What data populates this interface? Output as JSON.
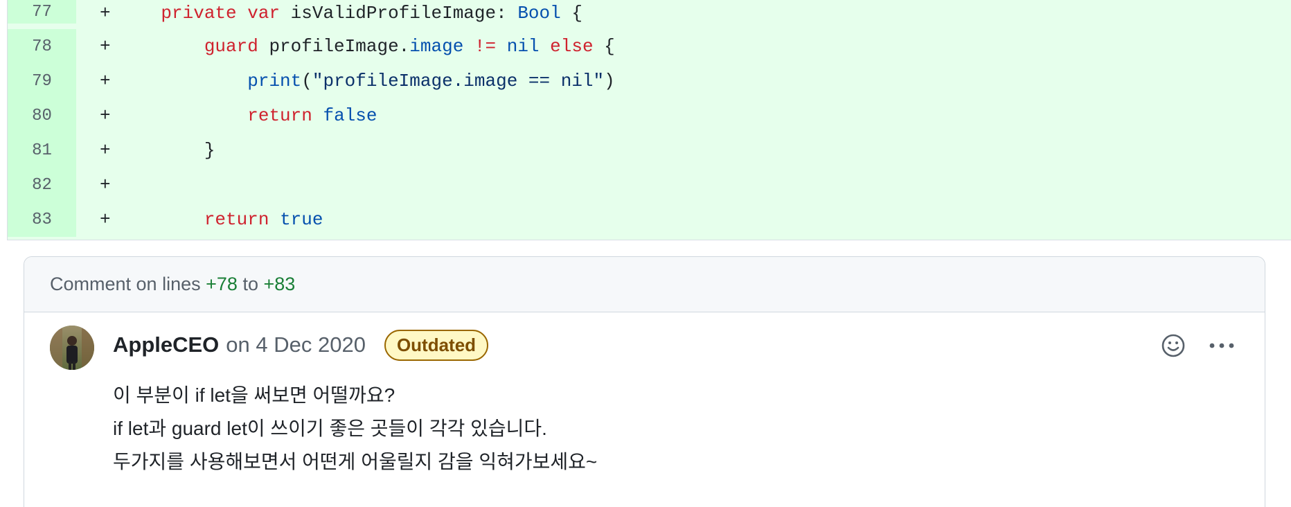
{
  "diff": {
    "lines": [
      {
        "number": "77",
        "marker": "+"
      },
      {
        "number": "78",
        "marker": "+"
      },
      {
        "number": "79",
        "marker": "+"
      },
      {
        "number": "80",
        "marker": "+"
      },
      {
        "number": "81",
        "marker": "+"
      },
      {
        "number": "82",
        "marker": "+"
      },
      {
        "number": "83",
        "marker": "+"
      }
    ],
    "code": {
      "l77": {
        "indent": "    ",
        "kw1": "private",
        "kw2": "var",
        "name": " isValidProfileImage: ",
        "type": "Bool",
        "tail": " {"
      },
      "l78": {
        "indent": "        ",
        "kw1": "guard",
        "mid": " profileImage.",
        "prop": "image",
        "op": " != ",
        "nil": "nil",
        "kw2": " else",
        "tail": " {"
      },
      "l79": {
        "indent": "            ",
        "fn": "print",
        "open": "(",
        "str": "\"profileImage.image == nil\"",
        "close": ")"
      },
      "l80": {
        "indent": "            ",
        "kw": "return",
        "val": "false"
      },
      "l81": {
        "indent": "        ",
        "text": "}"
      },
      "l82": {
        "text": ""
      },
      "l83": {
        "indent": "        ",
        "kw": "return",
        "val": "true"
      }
    }
  },
  "comment_thread": {
    "header_prefix": "Comment on lines",
    "from": "+78",
    "to_word": "to",
    "to": "+83",
    "author": "AppleCEO",
    "date": "on 4 Dec 2020",
    "badge": "Outdated",
    "icons": {
      "react": "smiley-icon",
      "more": "kebab-horizontal-icon"
    },
    "body": [
      "이 부분이 if let을 써보면 어떨까요?",
      "if let과 guard let이 쓰이기 좋은 곳들이 각각 있습니다.",
      "두가지를 사용해보면서 어떤게 어울릴지 감을 익혀가보세요~"
    ]
  },
  "colors": {
    "added_bg": "#e6ffec",
    "added_gutter": "#ccffd8",
    "keyword": "#cf222e",
    "type": "#0550ae",
    "badge_border": "#9a6700"
  }
}
